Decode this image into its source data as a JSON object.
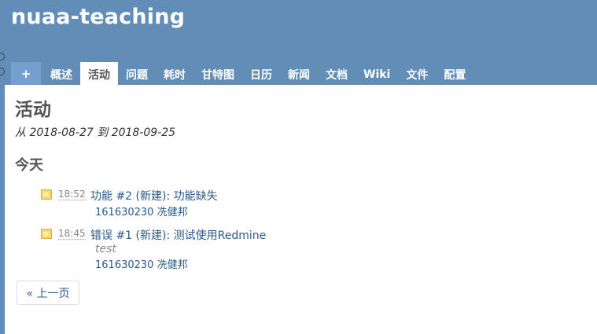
{
  "header": {
    "project_title": "nuaa-teaching"
  },
  "menu": {
    "new_label": "+",
    "items": [
      {
        "label": "概述"
      },
      {
        "label": "活动"
      },
      {
        "label": "问题"
      },
      {
        "label": "耗时"
      },
      {
        "label": "甘特图"
      },
      {
        "label": "日历"
      },
      {
        "label": "新闻"
      },
      {
        "label": "文档"
      },
      {
        "label": "Wiki"
      },
      {
        "label": "文件"
      },
      {
        "label": "配置"
      }
    ],
    "selected": "活动"
  },
  "content": {
    "heading": "活动",
    "date_range": "从 2018-08-27 到 2018-09-25",
    "day_heading": "今天",
    "events": [
      {
        "time": "18:52",
        "title": "功能 #2 (新建): 功能缺失",
        "description": "",
        "author": "161630230 冼健邦",
        "icon": "issue-icon"
      },
      {
        "time": "18:45",
        "title": "错误 #1 (新建): 测试使用Redmine",
        "description": "test",
        "author": "161630230 冼健邦",
        "icon": "issue-icon"
      }
    ],
    "prev_label": "« 上一页"
  },
  "colors": {
    "header_bg": "#628db6",
    "link": "#2a5a8a",
    "new_button_bg": "#759fcf"
  }
}
